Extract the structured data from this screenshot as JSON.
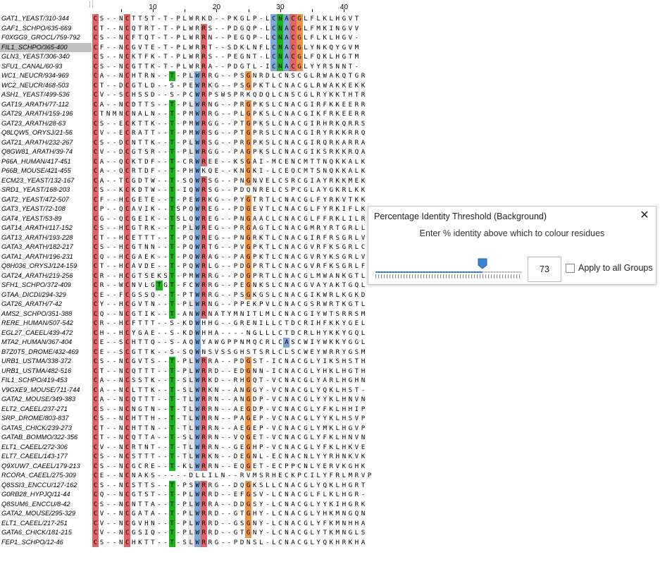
{
  "ruler": {
    "labels": [
      "10",
      "20",
      "30",
      "40"
    ]
  },
  "alignment": {
    "sequences": [
      {
        "name": "GAT1_YEAST/310-344",
        "seq": "CS--NCTTST-T-PLWRKD--PKGLP-LCNACGLFLKLHGVT"
      },
      {
        "name": "GAF1_SCHPO/635-669",
        "seq": "CT--NCQTRT-T-PLWRRS--PDGQP-LCNACGLFMKINGVV"
      },
      {
        "name": "F0XGG9_GROCL/759-792",
        "seq": "CS--NCFTQT-T-PLWRRN--PEGQP-LCNACGLFLKLHGV-"
      },
      {
        "name": "FIL1_SCHPO/365-400",
        "seq": "CF--NCGVTE-T-PLWRRT--SDKLNFLCNACGLYNKQYGVM"
      },
      {
        "name": "GLN3_YEAST/306-340",
        "seq": "CS--NCKTFK-T-PLWRRS--PEGNT-LCNACGLFQKLHGTM"
      },
      {
        "name": "SFU1_CANAL/60-93",
        "seq": "CS--NCGTTK-T-PLWRRA--PDGTL-ICNACGLYYRSNNT-"
      },
      {
        "name": "WC1_NEUCR/934-969",
        "seq": "CA--NCHTRN--T-PLWRRG--PSGNRDLCNSCGLRWAKQTGR"
      },
      {
        "name": "WC2_NEUCR/468-503",
        "seq": "CT--DCGTLD--S-PEWRKG--PSGPKTLCNACGLRWAKKEKK"
      },
      {
        "name": "ASH1_YEAST/499-536",
        "seq": "CV--SCHSSD--S-PCWRPSWSPRKQDQLCNSCGLRYKKTHTR"
      },
      {
        "name": "GAT19_ARATH/77-112",
        "seq": "CA--NCDTTS--T-PLWRNG--PRGPKSLCNACGIRFKKEERR"
      },
      {
        "name": "GAT29_ARATH/159-196",
        "seq": "CTNMNCNALN--T-PMWRRG--PLGPKSLCNACGIKFRKEERR"
      },
      {
        "name": "GAT23_ARATH/28-63",
        "seq": "CS--ECKTTK--T-PMWRGG--PTGPKSLCNACGIRHRKQRRS"
      },
      {
        "name": "Q8LQW5_ORYSJ/21-56",
        "seq": "CV--ECRATT--T-PMWRSG--PTGPRSLCNACGIRYRKKRRQ"
      },
      {
        "name": "GAT21_ARATH/232-267",
        "seq": "CS--DCNTTK--T-PLWRSG--PRGPKSLCNACGIRQRKARRA"
      },
      {
        "name": "Q8GW81_ARATH/39-74",
        "seq": "CV--DCGTSR--T-PLWRGG--PAGPKSLCNACGIKSRKKRQA"
      },
      {
        "name": "P66A_HUMAN/417-451",
        "seq": "CA--QCKTDF--T-CRWREE--KSGAI-MCENCMTTNQKKALK"
      },
      {
        "name": "P66B_MOUSE/421-455",
        "seq": "CA--QCRTDF--T-PHWKQE--KNGKI-LCEQCMTSNQKKALK"
      },
      {
        "name": "ECM23_YEAST/132-167",
        "seq": "CA--TCGDTW--T-SQWRSG--PNGNVELCSRCGIAYRKKMEK"
      },
      {
        "name": "SRD1_YEAST/168-203",
        "seq": "CS--KCKDTW--T-IQWRSG--PDQNRELCSPCGLAYGKRLKK"
      },
      {
        "name": "GAT2_YEAST/472-507",
        "seq": "CF--HCGETE--T-PEWRKG--PYGTRTLCNACGLFYRKVTKK"
      },
      {
        "name": "GAT3_YEAST/72-108",
        "seq": "CP--QCAVIK--TSPQWREG--PDGEVTLCNACGLFYRKIFLK"
      },
      {
        "name": "GAT4_YEAST/53-89",
        "seq": "CG--QCGEIK--TSLQWREG--PNGAACLCNACGLFFRKLILR"
      },
      {
        "name": "GAT14_ARATH/117-152",
        "seq": "CS--HCGTRK--T-PLWREG--PRGAGTLCNACGMRYRTGRLL"
      },
      {
        "name": "GAT13_ARATH/193-228",
        "seq": "CT--HCETTT--T-PQWREG--PNGRKTLCNACGIRFRSGRLV"
      },
      {
        "name": "GATA3_ARATH/182-217",
        "seq": "CS--HCGTNN--T-PQWRTG--PVGPKTLCNACGVRFKSGRLC"
      },
      {
        "name": "GATA1_ARATH/196-231",
        "seq": "CQ--HCGAEK--T-PQWRAG--PAGPKTLCNACGVRYKSGRLV"
      },
      {
        "name": "Q8H036_ORYSJ/124-159",
        "seq": "CT--HCAVDE--T-PQWRLG--PDGPRTLCNACGVRFKSGRLF"
      },
      {
        "name": "GAT24_ARATH/219-256",
        "seq": "CR--HCGTSEKST-PMWRRG--PDGPRTLCNACGLMWANKGTL"
      },
      {
        "name": "SFH1_SCHPO/372-409",
        "seq": "CR--WCNVLGTGT-FCWRRG--PEGNKSLCNACGVAYAKTGQL"
      },
      {
        "name": "GTAA_DICDI/294-329",
        "seq": "CE--FCGSSQ--T-PTWRRG--PSGKGSLCNACGIKWRLKGKD"
      },
      {
        "name": "GAT26_ARATH/7-42",
        "seq": "CY--HCGVTN--T-PLWRNG--PPEKPVLCNACGSRWRTKGTL"
      },
      {
        "name": "AMS2_SCHPO/351-388",
        "seq": "CQ--NCGTIK--T-ANWRNATYMNITLMLCNACGIYWTSRRSM"
      },
      {
        "name": "RERE_HUMAN/507-542",
        "seq": "CR--HCFTTT--S-KDWHHG--GRENILLCTDCRIHFKKYGEL"
      },
      {
        "name": "EGL27_CAEEL/439-472",
        "seq": "CH--HCYGAE--S-KDWHHA----NGLLLCTDCRLHYKKYGQL"
      },
      {
        "name": "MTA2_HUMAN/367-404",
        "seq": "CE--SCHTTQ--S-AQWYAWGPPNMQCRLCASCWIYWKKYGGL"
      },
      {
        "name": "B7Z0T5_DROME/432-469",
        "seq": "CE--SCGTTK--S-SQWNSVSSGHSTSRLCLSCWEYWRRYGSM"
      },
      {
        "name": "URB1_USTMA/338-372",
        "seq": "CS--NCGVTS--T-PLWRRA--PDGST-ICNACGLYIKSHSTH"
      },
      {
        "name": "URB1_USTMA/482-516",
        "seq": "CT--NCQTTT--T-PLWRRD--EDGNN-ICNACGLYHKLHGTH"
      },
      {
        "name": "FIL1_SCHPO/419-453",
        "seq": "CA--NCSSTK--T-SLWRKD--RHGQT-VCNACGLYARLHGHN"
      },
      {
        "name": "V9GXE9_MOUSE/711-744",
        "seq": "CA--NCLTTK--T-SLWRKN--ANGGY-VCNACGLYQKLHST-"
      },
      {
        "name": "GATA2_MOUSE/349-383",
        "seq": "CA--NCQTTT--T-TLWRRN--ANGDP-VCNACGLYYKLHNVN"
      },
      {
        "name": "ELT2_CAEEL/237-271",
        "seq": "CS--NCNGTN--T-TLWRRN--AEGDP-VCNACGLYFKLHHIP"
      },
      {
        "name": "SRP_DROME/803-837",
        "seq": "CS--NCHTTH--T-TLWRRN--PAGEP-VCNACGLYYKLHSVP"
      },
      {
        "name": "GATA5_CHICK/239-273",
        "seq": "CT--NCHTTN--T-TLWRRN--AEGEP-VCNACGLYMKLHGVP"
      },
      {
        "name": "GATAB_BOMMO/322-356",
        "seq": "CT--NCQTTA--T-SLWRRN--VQGET-VCNACGLYFKLHNVN"
      },
      {
        "name": "ELT1_CAEEL/272-306",
        "seq": "CV--NCRTNT--T-TLWRRN--GEGHP-VCNACGLYFKLHKVE"
      },
      {
        "name": "ELT7_CAEEL/143-177",
        "seq": "CS--NCSTTT--T-TLWRKN--DEGNL-ECNACNLYYRHNKVK"
      },
      {
        "name": "Q9XUW7_CAEEL/179-213",
        "seq": "CS--NCGCRE--T-KLWRRN--EQGET-ECPPCNLYERVKGHK"
      },
      {
        "name": "RCORA_CAEEL/275-309",
        "seq": "CE--NCNAKS-----DLLILN--RVMSRHECKPCILYFRLMRVP"
      },
      {
        "name": "Q8SSI3_ENCCU/127-162",
        "seq": "CS--NCSTTS--T-PSWRRG--DQGKSLLCNACGLYQKLHGRT"
      },
      {
        "name": "G0RB28_HYPJQ/11-44",
        "seq": "CQ--NCGTST--T-PLWRRD--EFGSV-LCNACGLFLKLHGR-"
      },
      {
        "name": "Q8SUM6_ENCCU/8-42",
        "seq": "CS--NCNTTA--T-PLWRRA--DDGSY-LCNACGLYYKIHGRK"
      },
      {
        "name": "GATA2_MOUSE/295-329",
        "seq": "CV--NCGATA--T-PLWRRD--GTGHY-LCNACGLYHKMNGQN"
      },
      {
        "name": "ELT1_CAEEL/217-251",
        "seq": "CV--NCGVHN--T-PLWRRD--GSGNY-LCNACGLYFKMNHHA"
      },
      {
        "name": "GATA6_CHICK/181-215",
        "seq": "CV--NCGSIQ--T-PLWRRD--GTGNY-LCNACGLYTKMNGLS"
      },
      {
        "name": "FEP1_SCHPO/12-46",
        "seq": "CS--NCHKTT--T-SLWRRG--PDNSL-LCNACGLYQKHRKHA"
      }
    ]
  },
  "dialog": {
    "title": "Percentage Identity Threshold (Background)",
    "close_glyph": "✕",
    "prompt": "Enter % identity above which to colour residues",
    "slider_percent": 73,
    "value": "73",
    "apply_label": "Apply to all Groups",
    "apply_checked": false
  },
  "colors": {
    "cys": "#e06666",
    "thr": "#19b419",
    "trp_col": "#7fa8d8",
    "arg_col": "#e06666",
    "gly_col": "#e8954a",
    "accent": "#3a84d3"
  }
}
